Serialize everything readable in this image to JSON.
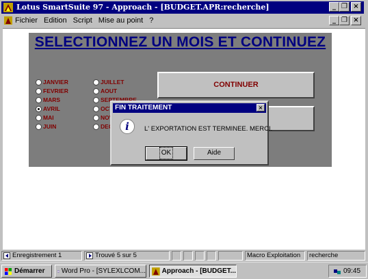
{
  "window": {
    "title": "Lotus SmartSuite 97  -  Approach - [BUDGET.APR:recherche]",
    "title_buttons": [
      "_",
      "❐",
      "×"
    ]
  },
  "menu": {
    "items": [
      "Fichier",
      "Edition",
      "Script",
      "Mise au point",
      "?"
    ]
  },
  "form": {
    "heading": "SELECTIONNEZ UN MOIS ET CONTINUEZ",
    "months_col1": [
      "JANVIER",
      "FEVRIER",
      "MARS",
      "AVRIL",
      "MAI",
      "JUIN"
    ],
    "months_col2": [
      "JUILLET",
      "AOUT",
      "SEPTEMBRE",
      "OCT",
      "NOV",
      "DEC"
    ],
    "selected_month": "AVRIL",
    "continue_button": "CONTINUER",
    "second_button": ""
  },
  "dialog": {
    "title": "FIN TRAITEMENT",
    "message": "L' EXPORTATION EST TERMINEE. MERCI.",
    "ok_label": "OK",
    "help_label": "Aide",
    "close_glyph": "×",
    "icon_glyph": "i"
  },
  "status": {
    "record": "Enregistrement 1",
    "found": "Trouvé 5 sur 5",
    "macro": "Macro Exploitation",
    "view": "recherche"
  },
  "taskbar": {
    "start_label": "Démarrer",
    "tasks": [
      "Word Pro - [SYLEXLCOM...",
      "Approach - [BUDGET..."
    ],
    "clock": "09:45"
  },
  "colors": {
    "titlebar": "#000080",
    "heading": "#000080",
    "month_text": "#800000",
    "panel": "#7d7d7d",
    "face": "#c0c0c0"
  }
}
